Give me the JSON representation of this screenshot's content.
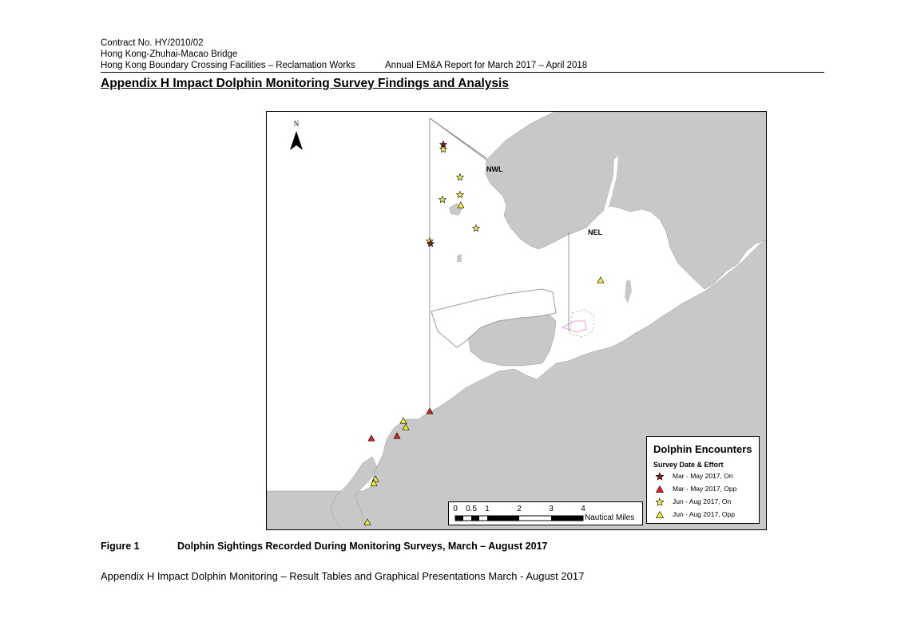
{
  "header": {
    "contract": "Contract No. HY/2010/02",
    "project": "Hong Kong-Zhuhai-Macao Bridge",
    "works": "Hong Kong Boundary Crossing Facilities – Reclamation Works",
    "report": "Annual EM&A Report for March 2017 – April 2018"
  },
  "appendix_title": "Appendix H   Impact Dolphin Monitoring Survey Findings and Analysis",
  "map": {
    "north_label": "N",
    "area_labels": {
      "nwl": "NWL",
      "nel": "NEL"
    },
    "colors": {
      "land": "#c8c8c8",
      "water": "#ffffff",
      "survey_line": "#808080"
    },
    "legend": {
      "title": "Dolphin Encounters",
      "subtitle": "Survey Date & Effort",
      "items": [
        {
          "label": "Mar - May 2017, On",
          "symbol": "star",
          "color": "#8b1a1a"
        },
        {
          "label": "Mar - May 2017, Opp",
          "symbol": "triangle",
          "color": "#e02020"
        },
        {
          "label": "Jun - Aug 2017, On",
          "symbol": "star",
          "color": "#f0f050"
        },
        {
          "label": "Jun - Aug 2017, Opp",
          "symbol": "triangle",
          "color": "#f5f030"
        }
      ]
    },
    "scale": {
      "ticks": [
        "0",
        "0.5",
        "1",
        "2",
        "3",
        "4"
      ],
      "unit": "Nautical Miles"
    }
  },
  "figure": {
    "label": "Figure 1",
    "caption": "Dolphin Sightings Recorded During Monitoring Surveys, March – August 2017"
  },
  "footer": "Appendix H Impact Dolphin Monitoring – Result Tables and Graphical Presentations  March - August 2017"
}
